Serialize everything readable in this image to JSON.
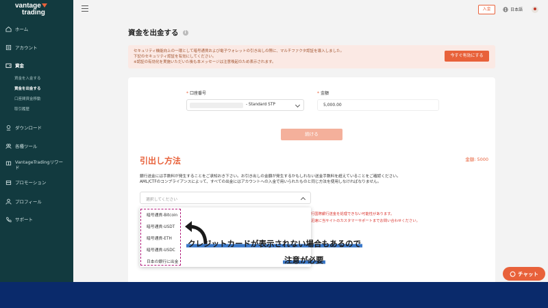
{
  "brand": {
    "line1": "vantage",
    "line2": "trading"
  },
  "sidebar": {
    "items": [
      {
        "label": "ホーム",
        "icon": "home-icon"
      },
      {
        "label": "アカウント",
        "icon": "account-icon"
      },
      {
        "label": "資金",
        "icon": "wallet-icon"
      },
      {
        "label": "ダウンロード",
        "icon": "download-icon"
      },
      {
        "label": "各種ツール",
        "icon": "tools-icon"
      },
      {
        "label": "VantageTradingリワード",
        "icon": "reward-icon"
      },
      {
        "label": "プロモーション",
        "icon": "promotion-icon"
      },
      {
        "label": "プロフィール",
        "icon": "profile-icon"
      },
      {
        "label": "サポート",
        "icon": "support-icon"
      }
    ],
    "sub_items": [
      {
        "label": "資金を入金する"
      },
      {
        "label": "資金を出金する"
      },
      {
        "label": "口座間資金移動"
      },
      {
        "label": "取引履歴"
      }
    ]
  },
  "topbar": {
    "deposit": "入金",
    "language": "日本語"
  },
  "page": {
    "title": "資金を出金する",
    "notice_line1": "セキュリティ機能向上の一環として暗号通貨および電子ウォレットの引き出しの際に、マルチファクタ認証を導入しました。",
    "notice_line2": "下記のセキュリティ認証を有効にしてください。",
    "notice_line3": "※認証の有効化を実施いただいた後も本メッセージは注意喚起のため表示されます。",
    "enable_button": "今すぐ有効にする"
  },
  "form": {
    "account_label": "口座番号",
    "account_value": "- Standard STP",
    "amount_label": "金額",
    "amount_value": "5,000.00",
    "continue_button": "続ける"
  },
  "method": {
    "title": "引出し方法",
    "balance": "金額: 5000",
    "desc_line1": "銀行送金には手数料が発生することをご承知おき下さい。お引き出しの金額が発生するかもしれない送金手数料を超えていることをご確認ください。",
    "desc_line2": "AML/CTFのコンプライアンスによって、すべての出金にはアカウントへの入金で用いられたものと同じ方法を使用しなければなりません。",
    "placeholder": "選択してください",
    "warn_line1": "行国際銀行送金を処理できない可能性があります。",
    "warn_line2": "迅速に当サイトのカスタマーサポートまでお問い合わせください。",
    "options": [
      "暗号通貨-Bitcoin",
      "暗号通貨-USDT",
      "暗号通貨-ETH",
      "暗号通貨-USDC",
      "日本の銀行に出金"
    ]
  },
  "annotation": {
    "line1": "クレジットカードが表示されない場合もあるので",
    "line2": "注意が必要"
  },
  "chat": {
    "label": "チャット"
  },
  "colors": {
    "accent": "#e8613a",
    "sidebar": "#123a3f",
    "highlight": "#b0197a",
    "band": "#0a2a6b"
  }
}
